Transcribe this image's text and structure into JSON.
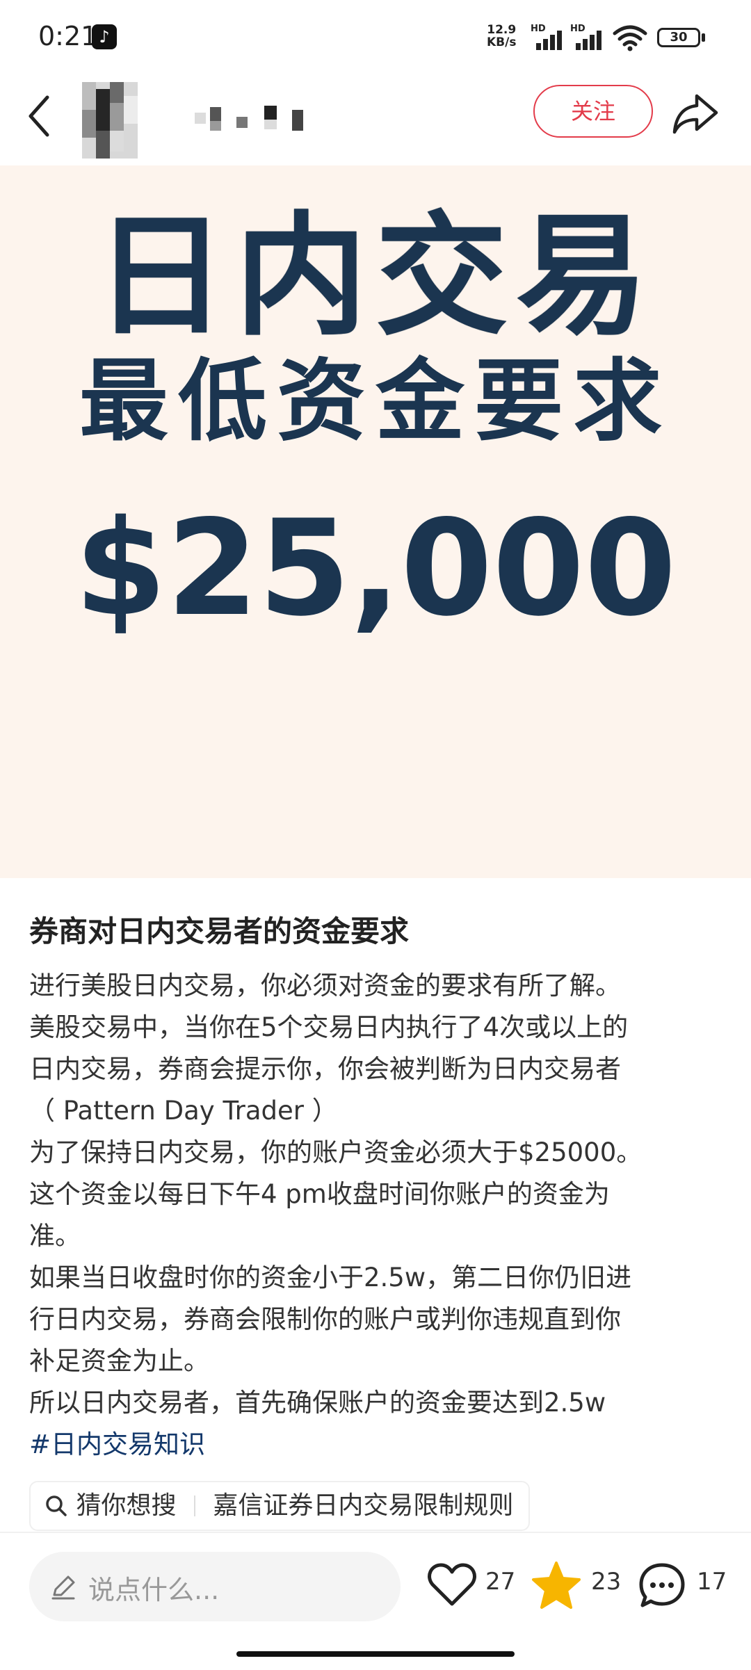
{
  "status_bar": {
    "time": "0:21",
    "net_speed_value": "12.9",
    "net_speed_unit": "KB/s",
    "signal1_label": "HD",
    "signal2_label": "HD",
    "battery": "30"
  },
  "header": {
    "follow_label": "关注"
  },
  "poster": {
    "line1": "日内交易",
    "line2": "最低资金要求",
    "amount": "$25,000"
  },
  "post": {
    "title": "券商对日内交易者的资金要求",
    "body_lines": [
      "进行美股日内交易，你必须对资金的要求有所了解。",
      "美股交易中，当你在5个交易日内执行了4次或以上的",
      "日内交易，券商会提示你，你会被判断为日内交易者",
      "（ Pattern Day Trader ）",
      "为了保持日内交易，你的账户资金必须大于$25000。",
      "这个资金以每日下午4 pm收盘时间你账户的资金为",
      "准。",
      "如果当日收盘时你的资金小于2.5w，第二日你仍旧进",
      "行日内交易，券商会限制你的账户或判你违规直到你",
      "补足资金为止。",
      "所以日内交易者，首先确保账户的资金要达到2.5w"
    ],
    "hashtag": "#日内交易知识",
    "search_label": "猜你想搜",
    "search_query": "嘉信证券日内交易限制规则"
  },
  "bottom_bar": {
    "comment_placeholder": "说点什么...",
    "likes": "27",
    "stars": "23",
    "comments": "17",
    "star_color": "#f7b500"
  }
}
